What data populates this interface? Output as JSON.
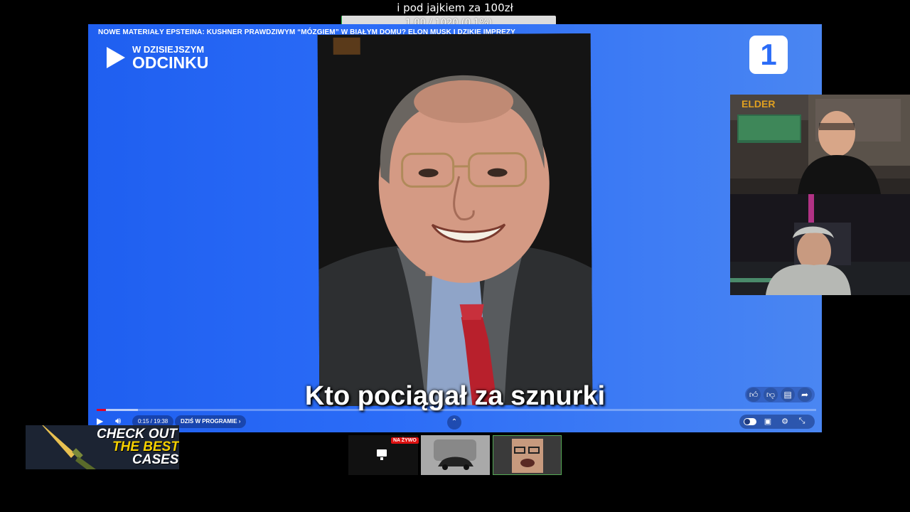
{
  "goal": {
    "text": "i pod jajkiem za 100zł",
    "progress_text": "1.00 / 1020 (0.1%)",
    "fraction": 0.001,
    "bar_color": "#dcdcdc",
    "fill_color": "#27c24c"
  },
  "video": {
    "title": "NOWE MATERIAŁY EPSTEINA: KUSHNER PRAWDZIWYM “MÓZGIEM” W BIAŁYM DOMU? ELON MUSK I DZIKIE IMPREZY",
    "today_line1": "W DZISIEJSZYM",
    "today_line2": "ODCINKU",
    "channel_logo": "1",
    "subtitle": "Kto pociągał za sznurki",
    "background": "#2b6cf7"
  },
  "player": {
    "time": "0:15 / 19:38",
    "program_label": "DZIŚ W PROGRAMIE",
    "progress_fraction": 0.013,
    "progress_color": "#e0002a",
    "actions": [
      "thumbs-up-icon",
      "thumbs-down-icon",
      "comment-icon",
      "share-icon"
    ],
    "right_controls": [
      "toggle",
      "subtitles-icon",
      "settings-icon",
      "fullscreen-icon"
    ]
  },
  "webcam": {
    "sign": "ELDER"
  },
  "ad": {
    "line1": "CHECK OUT",
    "line2": "THE BEST",
    "line3": "CASES",
    "accent": "#f5d000"
  },
  "thumbnails": {
    "live_badge": "NA ŻYWO"
  }
}
